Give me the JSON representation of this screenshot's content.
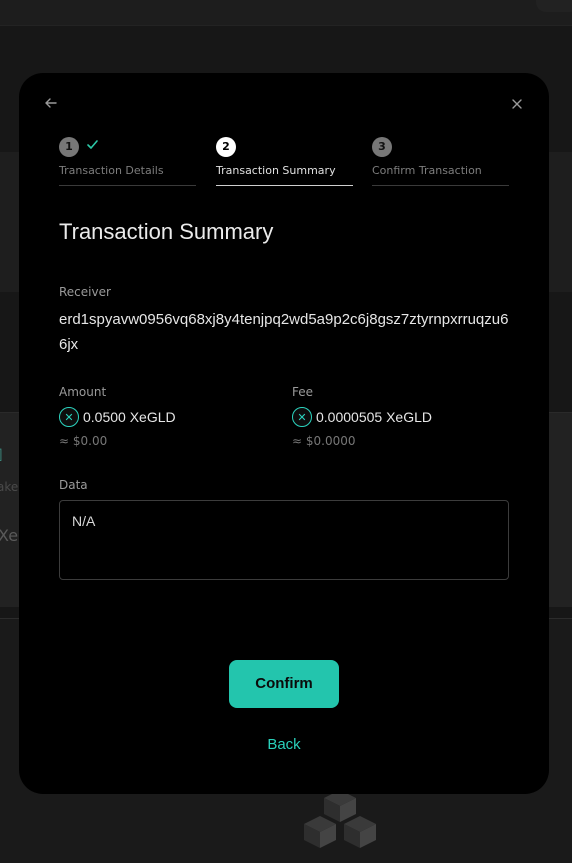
{
  "modal": {
    "steps": [
      {
        "number": "1",
        "label": "Transaction Details",
        "completed": true
      },
      {
        "number": "2",
        "label": "Transaction Summary",
        "active": true
      },
      {
        "number": "3",
        "label": "Confirm Transaction"
      }
    ],
    "title": "Transaction Summary",
    "receiver": {
      "label": "Receiver",
      "value": "erd1spyavw0956vq68xj8y4tenjpq2wd5a9p2c6j8gsz7ztyrnpxrruqzu66jx"
    },
    "amount": {
      "label": "Amount",
      "value": "0.0500 XeGLD",
      "usd": "≈ $0.00"
    },
    "fee": {
      "label": "Fee",
      "value": "0.0000505 XeGLD",
      "usd": "≈ $0.0000"
    },
    "data": {
      "label": "Data",
      "value": "N/A"
    },
    "confirm_label": "Confirm",
    "back_label": "Back"
  },
  "icons": {
    "back": "arrow-left-icon",
    "close": "close-icon",
    "check": "check-icon",
    "token": "multiversx-icon"
  },
  "colors": {
    "accent": "#23c5ad",
    "modal_bg": "#000000",
    "page_bg": "#171717"
  }
}
